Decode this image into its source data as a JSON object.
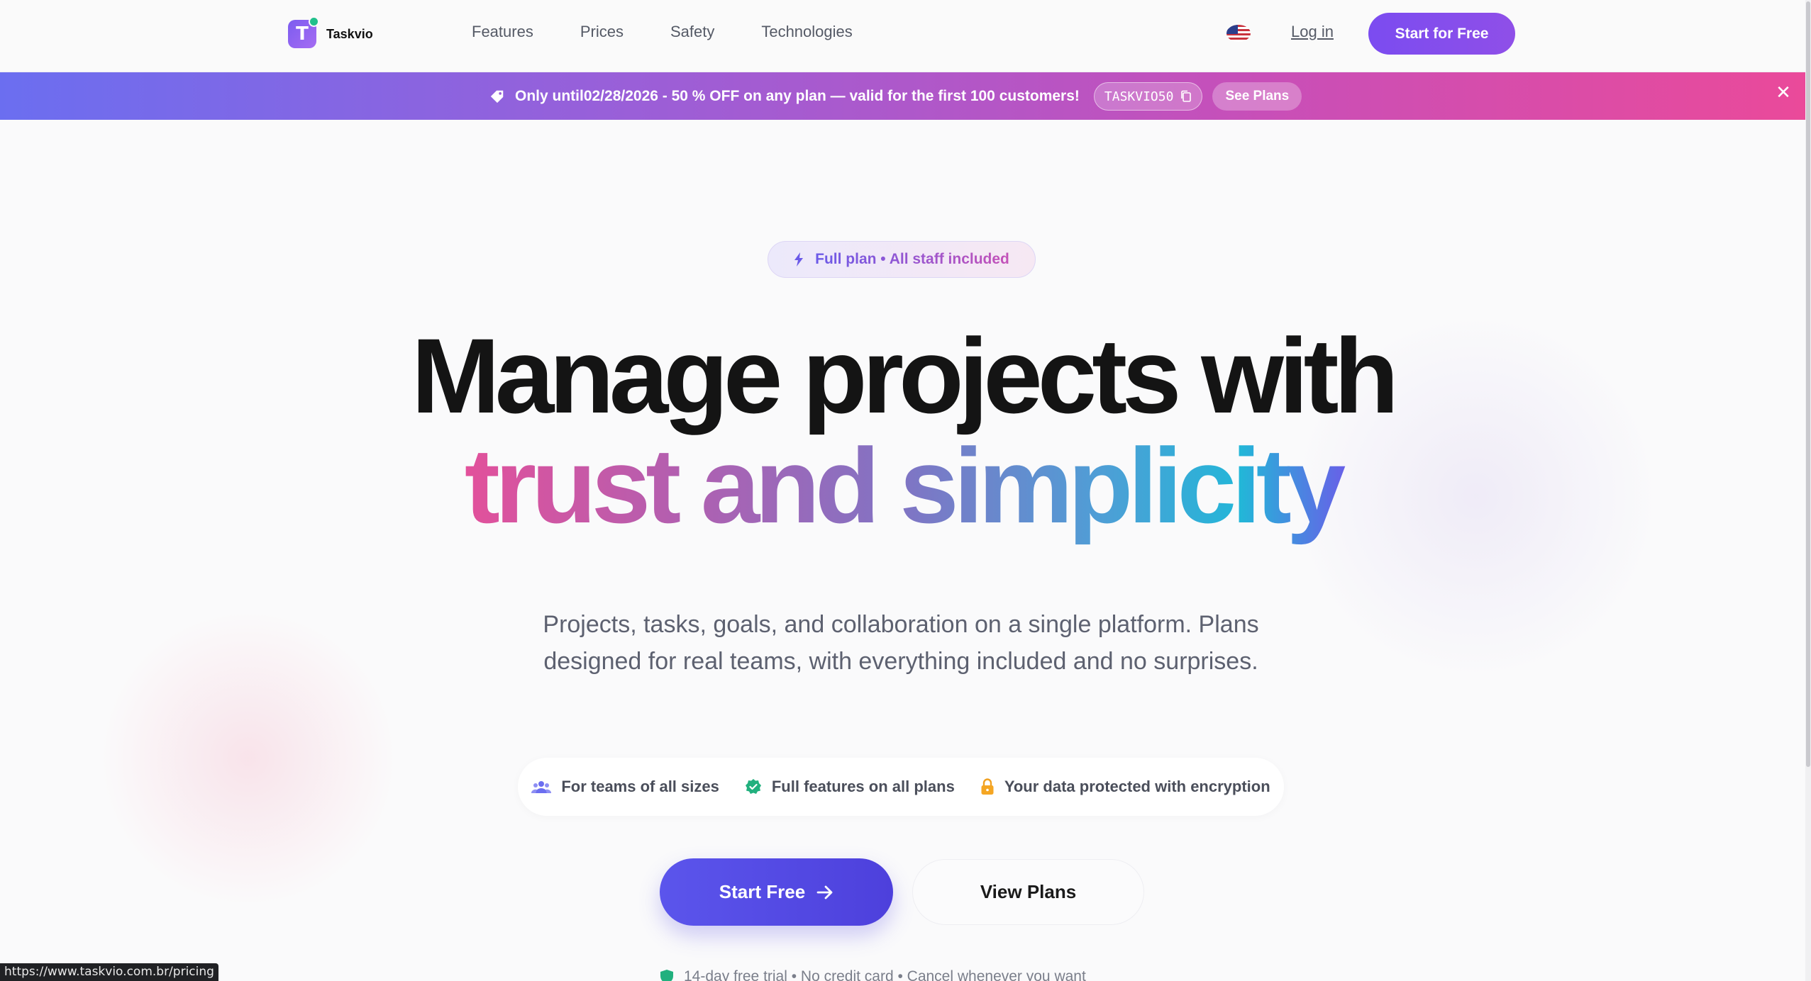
{
  "brand": {
    "name": "Taskvio",
    "logo_letter": "T"
  },
  "nav": {
    "items": [
      {
        "label": "Features"
      },
      {
        "label": "Prices"
      },
      {
        "label": "Safety"
      },
      {
        "label": "Technologies"
      }
    ],
    "login_label": "Log in",
    "cta_label": "Start for Free",
    "language_icon": "us-flag-icon"
  },
  "promo": {
    "text": "Only until02/28/2026 - 50 % OFF on any plan — valid for the first 100 customers!",
    "coupon_code": "TASKVIO50",
    "see_plans_label": "See Plans",
    "close_glyph": "✕",
    "gradient": [
      "#6b6ef0",
      "#9a5fd8",
      "#c84fb8",
      "#ea4a9a"
    ]
  },
  "hero": {
    "badge": "Full plan • All staff included",
    "title_line1": "Manage projects with",
    "title_line2": "trust and simplicity",
    "lead": "Projects, tasks, goals, and collaboration on a single platform. Plans designed for real teams, with everything included and no surprises.",
    "features": [
      {
        "icon": "team-icon",
        "label": "For teams of all sizes"
      },
      {
        "icon": "verified-check-icon",
        "label": "Full features on all plans"
      },
      {
        "icon": "lock-icon",
        "label": "Your data protected with encryption"
      }
    ],
    "cta_primary": "Start Free",
    "cta_secondary": "View Plans",
    "trial_note": "14-day free trial • No credit card • Cancel whenever you want"
  },
  "status_bar": {
    "url": "https://www.taskvio.com.br/pricing"
  },
  "colors": {
    "accent": "#7b4cf0",
    "cta_primary": "#5b55ec",
    "title": "#141414",
    "body_text": "#5d6170"
  }
}
